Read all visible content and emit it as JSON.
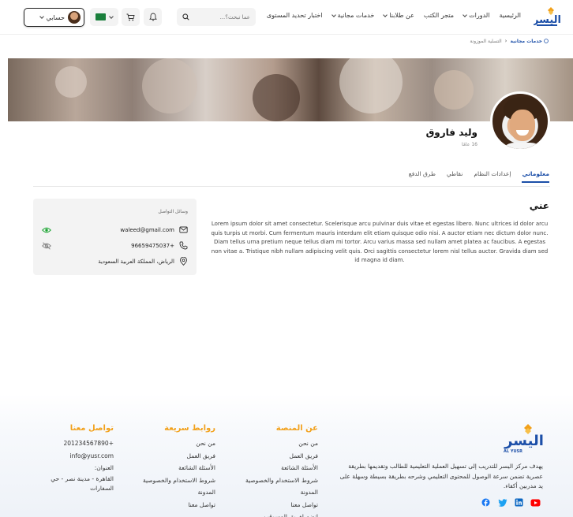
{
  "header": {
    "logo_text": "اليسر",
    "nav": [
      {
        "label": "الرئيسية",
        "dropdown": false
      },
      {
        "label": "الدورات",
        "dropdown": true
      },
      {
        "label": "متجر الكتب",
        "dropdown": false
      },
      {
        "label": "عن طلابنا",
        "dropdown": true
      },
      {
        "label": "خدمات مجانية",
        "dropdown": true
      },
      {
        "label": "اختبار تحديد المستوى",
        "dropdown": false
      }
    ],
    "search_placeholder": "عما تبحث؟...",
    "account_label": "حسابي"
  },
  "breadcrumb": {
    "home": "خدمات مجانية",
    "current": "التسلية الموزونة"
  },
  "profile": {
    "name": "وليد فاروق",
    "age": "16 عامًا"
  },
  "tabs": [
    {
      "label": "معلوماتي",
      "active": true
    },
    {
      "label": "إعدادات النظام",
      "active": false
    },
    {
      "label": "نقاطي",
      "active": false
    },
    {
      "label": "طرق الدفع",
      "active": false
    }
  ],
  "about": {
    "title": "عني",
    "text": "Lorem ipsum dolor sit amet consectetur. Scelerisque arcu pulvinar duis vitae et egestas libero. Nunc ultrices id dolor arcu quis turpis ut morbi. Cum fermentum mauris interdum elit etiam quisque odio nisi. A auctor etiam nec dictum dolor nunc. Diam tellus urna pretium neque tellus diam mi tortor. Arcu varius massa sed nullam amet platea ac faucibus. A egestas non vitae a. Tristique nibh nullam adipiscing velit quis. Orci sagittis consectetur lorem nisl tellus auctor. Gravida diam sed id magna id diam."
  },
  "contact": {
    "title": "وسائل التواصل",
    "email": "waleed@gmail.com",
    "phone": "+96659475037",
    "address": "الرياض، المملكة العربية السعودية"
  },
  "footer": {
    "description": "يهدف مركز اليسر للتدريب إلى تسهيل العملية التعليمية للطالب وتقديمها بطريقة عصرية تضمن سرعة الوصول للمحتوى التعليمي وشرحه بطريقة بسيطة وسهلة على يد مدربين أكفاء.",
    "logo_text": "اليسر",
    "logo_subtext": "AL YUSR",
    "about_platform": {
      "title": "عن المنصة",
      "links": [
        "من نحن",
        "فريق العمل",
        "الأسئلة الشائعة",
        "شروط الاستخدام والخصوصية",
        "المدونة",
        "تواصل معنا",
        "انضم لفريق المسوقين"
      ]
    },
    "quick_links": {
      "title": "روابط سريعة",
      "links": [
        "من نحن",
        "فريق العمل",
        "الأسئلة الشائعة",
        "شروط الاستخدام والخصوصية",
        "المدونة",
        "تواصل معنا"
      ]
    },
    "contact_us": {
      "title": "تواصل معنا",
      "phone": "+201234567890",
      "email": "info@yusr.com",
      "address_label": "العنوان:",
      "address": "القاهرة - مدينة نصر - حي السفارات"
    }
  },
  "colors": {
    "primary": "#1c4fa8",
    "accent": "#f2a11b",
    "facebook": "#1877f2",
    "linkedin": "#0a66c2",
    "twitter": "#1da1f2",
    "youtube": "#ff0000"
  }
}
